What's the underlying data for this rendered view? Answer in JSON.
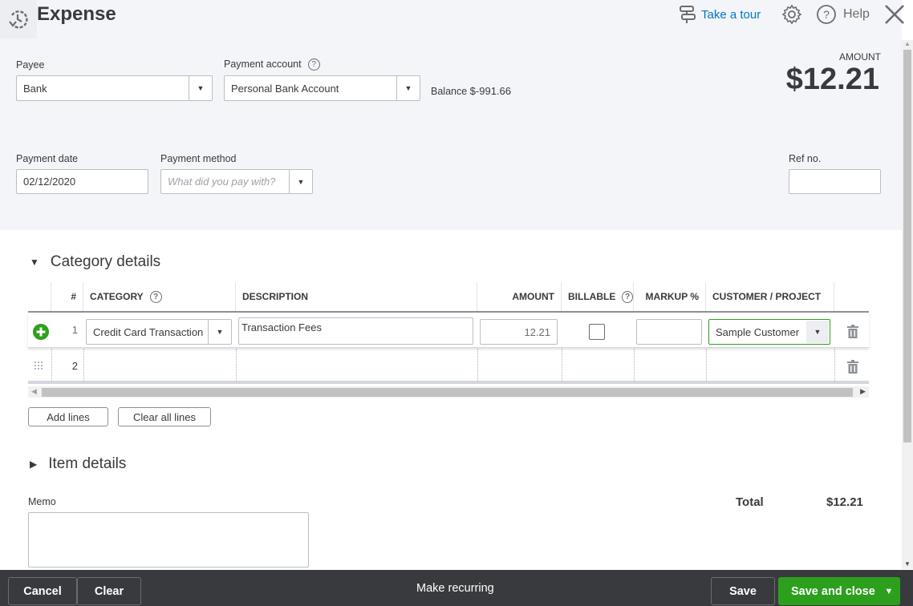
{
  "header": {
    "title": "Expense",
    "take_tour": "Take a tour",
    "help": "Help"
  },
  "form": {
    "payee": {
      "label": "Payee",
      "value": "Bank"
    },
    "payment_account": {
      "label": "Payment account",
      "value": "Personal Bank Account",
      "help": "?"
    },
    "balance": {
      "label": "Balance",
      "value": "$-991.66"
    },
    "amount": {
      "label": "AMOUNT",
      "value": "$12.21"
    },
    "payment_date": {
      "label": "Payment date",
      "value": "02/12/2020"
    },
    "payment_method": {
      "label": "Payment method",
      "placeholder": "What did you pay with?"
    },
    "ref_no": {
      "label": "Ref no.",
      "value": ""
    }
  },
  "category_details": {
    "title": "Category details",
    "columns": {
      "num": "#",
      "category": "CATEGORY",
      "description": "DESCRIPTION",
      "amount": "AMOUNT",
      "billable": "BILLABLE",
      "markup": "MARKUP %",
      "customer": "CUSTOMER / PROJECT"
    },
    "rows": [
      {
        "num": "1",
        "category": "Credit Card Transaction",
        "description": "Transaction Fees",
        "amount": "12.21",
        "billable": false,
        "markup": "",
        "customer": "Sample Customer"
      },
      {
        "num": "2",
        "category": "",
        "description": "",
        "amount": "",
        "billable": false,
        "markup": "",
        "customer": ""
      }
    ],
    "add_lines": "Add lines",
    "clear_all_lines": "Clear all lines"
  },
  "item_details": {
    "title": "Item details"
  },
  "memo": {
    "label": "Memo",
    "value": ""
  },
  "total": {
    "label": "Total",
    "value": "$12.21"
  },
  "footer": {
    "cancel": "Cancel",
    "clear": "Clear",
    "make_recurring": "Make recurring",
    "save": "Save",
    "save_and_close": "Save and close"
  },
  "colors": {
    "accent_green": "#2ca01c",
    "link_blue": "#0077c5",
    "footer_bg": "#393a3d"
  }
}
